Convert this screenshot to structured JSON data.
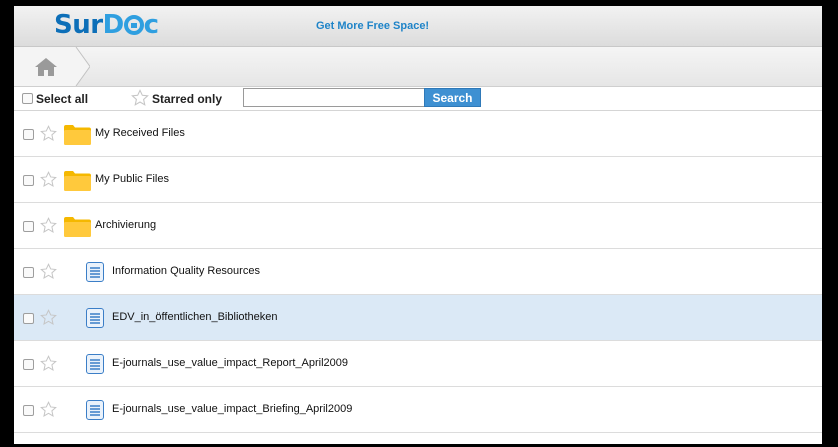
{
  "header": {
    "logo_prefix": "Sur",
    "logo_accent": "D",
    "logo_suffix": "c",
    "promo": "Get More Free Space!"
  },
  "toolbar": {
    "select_all": "Select all",
    "starred_only": "Starred only",
    "search_value": "",
    "search_button": "Search"
  },
  "colors": {
    "brand": "#0d6fb8",
    "button": "#3e90d2",
    "folder": "#f5b800",
    "doc": "#3b7ec7",
    "selected_row": "#dbe9f6"
  },
  "files": [
    {
      "name": "My Received Files",
      "type": "folder"
    },
    {
      "name": "My Public Files",
      "type": "folder"
    },
    {
      "name": "Archivierung",
      "type": "folder"
    },
    {
      "name": "Information Quality Resources",
      "type": "document"
    },
    {
      "name": "EDV_in_öffentlichen_Bibliotheken",
      "type": "document",
      "selected": true
    },
    {
      "name": "E-journals_use_value_impact_Report_April2009",
      "type": "document"
    },
    {
      "name": "E-journals_use_value_impact_Briefing_April2009",
      "type": "document"
    }
  ]
}
